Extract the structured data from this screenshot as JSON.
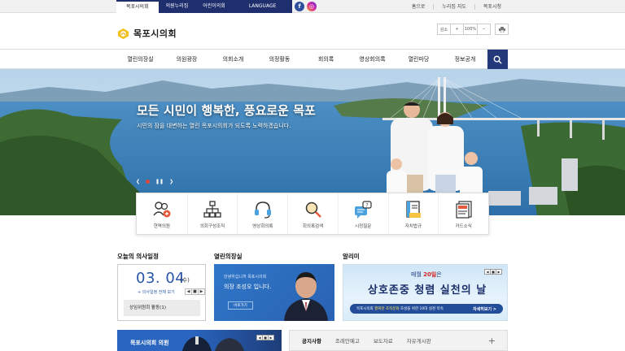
{
  "topbar": {
    "site_tabs": [
      "목포시의회",
      "의원누리집",
      "어린이의회",
      "LANGUAGE"
    ],
    "social": {
      "facebook_glyph": "f",
      "instagram_glyph": "◎"
    },
    "util_links": [
      "홈으로",
      "누리집 지도",
      "목포시청"
    ]
  },
  "header": {
    "site_name": "목포시의회",
    "zoom": {
      "zoom_out": "감소",
      "zoom_in": "+",
      "level": "100%",
      "minus": "−"
    }
  },
  "nav": {
    "items": [
      "열린의장실",
      "의원광장",
      "의회소개",
      "의정활동",
      "회의록",
      "영상회의록",
      "열린마당",
      "정보공개"
    ]
  },
  "hero": {
    "headline": "모든 시민이 행복한, 풍요로운 목포",
    "subline": "시민의 잠을 대변하는 열린 목포시의회가 되도록 노력하겠습니다.",
    "controls": {
      "prev": "❮",
      "pause": "❚❚",
      "next": "❯"
    }
  },
  "quick_menu": [
    {
      "label": "현역의원",
      "icon": "members-icon"
    },
    {
      "label": "의회구성조직",
      "icon": "org-chart-icon"
    },
    {
      "label": "영상회의록",
      "icon": "headset-icon"
    },
    {
      "label": "회의록검색",
      "icon": "search-minutes-icon"
    },
    {
      "label": "시정질문",
      "icon": "question-chat-icon"
    },
    {
      "label": "자치법규",
      "icon": "law-book-icon"
    },
    {
      "label": "카드소식",
      "icon": "card-news-icon"
    }
  ],
  "schedule": {
    "title": "오늘의 의사일정",
    "date": "03. 04",
    "weekday": "(수)",
    "more": "+ 의사일정 전체 보기",
    "pager": [
      "◀",
      "■",
      "▶"
    ],
    "item": "상임위원회 활동(1)"
  },
  "open_chair": {
    "title": "열린의장실",
    "greeting": "안녕하십니까 목포시의회",
    "chair": "의장 조성오 입니다.",
    "visit": "바로가기"
  },
  "notice": {
    "title": "알리미",
    "monthly_prefix": "매월 ",
    "monthly_day": "20일",
    "monthly_suffix": "은",
    "slogan": "상호존중 청렴 실천의 날",
    "band_text_prefix": "목포시의회 ",
    "band_text_highlight": "행복한 조직문화",
    "band_text_suffix": " 조성을 위한 10대 실천 약속",
    "band_more": "자세히보기 >",
    "pager": [
      "◀",
      "■",
      "▶"
    ]
  },
  "members_band": {
    "title": "목포시의회 의원",
    "pager": [
      "◀",
      "■",
      "▶"
    ]
  },
  "board": {
    "tabs": [
      "공지사항",
      "조례안예고",
      "보도자료",
      "자유게시판"
    ],
    "plus": "+"
  },
  "colors": {
    "navy": "#1f2f6e",
    "search_btn": "#24397a",
    "accent_blue": "#2755a8",
    "red": "#d42424"
  }
}
